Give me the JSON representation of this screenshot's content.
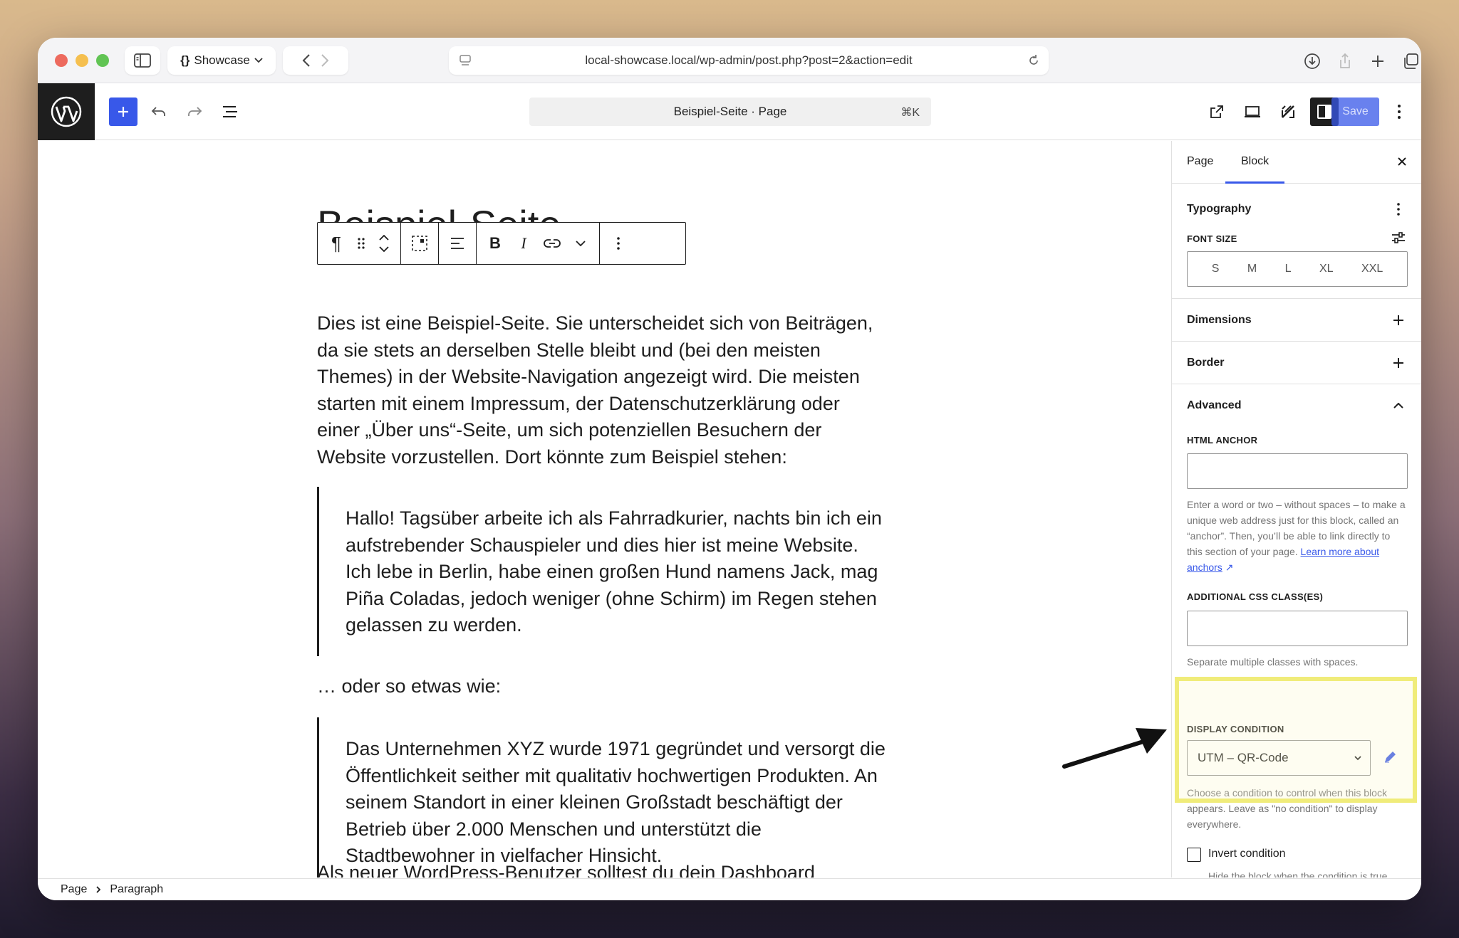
{
  "browser": {
    "tab_group": "Showcase",
    "url": "local-showcase.local/wp-admin/post.php?post=2&action=edit"
  },
  "editor": {
    "document_title": "Beispiel-Seite · Page",
    "shortcut": "⌘K",
    "save_label": "Save"
  },
  "content": {
    "title": "Beispiel-Seite",
    "para1": "Dies ist eine Beispiel-Seite. Sie unterscheidet sich von Beiträgen, da sie stets an derselben Stelle bleibt und (bei den meisten Themes) in der Website-Navigation angezeigt wird. Die meisten starten mit einem Impressum, der Datenschutzerklärung oder einer „Über uns“-Seite, um sich potenziellen Besuchern der Website vorzustellen. Dort könnte zum Beispiel stehen:",
    "quote1": "Hallo! Tagsüber arbeite ich als Fahrradkurier, nachts bin ich ein aufstrebender Schauspieler und dies hier ist meine Website. Ich lebe in Berlin, habe einen großen Hund namens Jack, mag Piña Coladas, jedoch weniger (ohne Schirm) im Regen stehen gelassen zu werden.",
    "para2": "… oder so etwas wie:",
    "quote2": "Das Unternehmen XYZ wurde 1971 gegründet und versorgt die Öffentlichkeit seither mit qualitativ hochwertigen Produkten. An seinem Standort in einer kleinen Großstadt beschäftigt der Betrieb über 2.000 Menschen und unterstützt die Stadtbewohner in vielfacher Hinsicht.",
    "para3": "Als neuer WordPress-Benutzer solltest du dein Dashboard"
  },
  "sidebar": {
    "tabs": [
      "Page",
      "Block"
    ],
    "typography": {
      "title": "Typography",
      "font_size_label": "FONT SIZE",
      "sizes": [
        "S",
        "M",
        "L",
        "XL",
        "XXL"
      ]
    },
    "dimensions": "Dimensions",
    "border": "Border",
    "advanced": {
      "title": "Advanced",
      "html_anchor_label": "HTML ANCHOR",
      "html_anchor_help": "Enter a word or two – without spaces – to make a unique web address just for this block, called an “anchor”. Then, you’ll be able to link directly to this section of your page.",
      "learn_more": "Learn more about anchors",
      "css_label": "ADDITIONAL CSS CLASS(ES)",
      "css_help": "Separate multiple classes with spaces."
    },
    "display_condition": {
      "label": "DISPLAY CONDITION",
      "selected": "UTM – QR-Code",
      "help": "Choose a condition to control when this block appears. Leave as \"no condition\" to display everywhere."
    },
    "invert": {
      "label": "Invert condition",
      "help": "Hide the block when the condition is true instead of false."
    }
  },
  "breadcrumb": [
    "Page",
    "Paragraph"
  ],
  "colors": {
    "accent": "#3858e9",
    "highlight": "#f0ec7a"
  }
}
